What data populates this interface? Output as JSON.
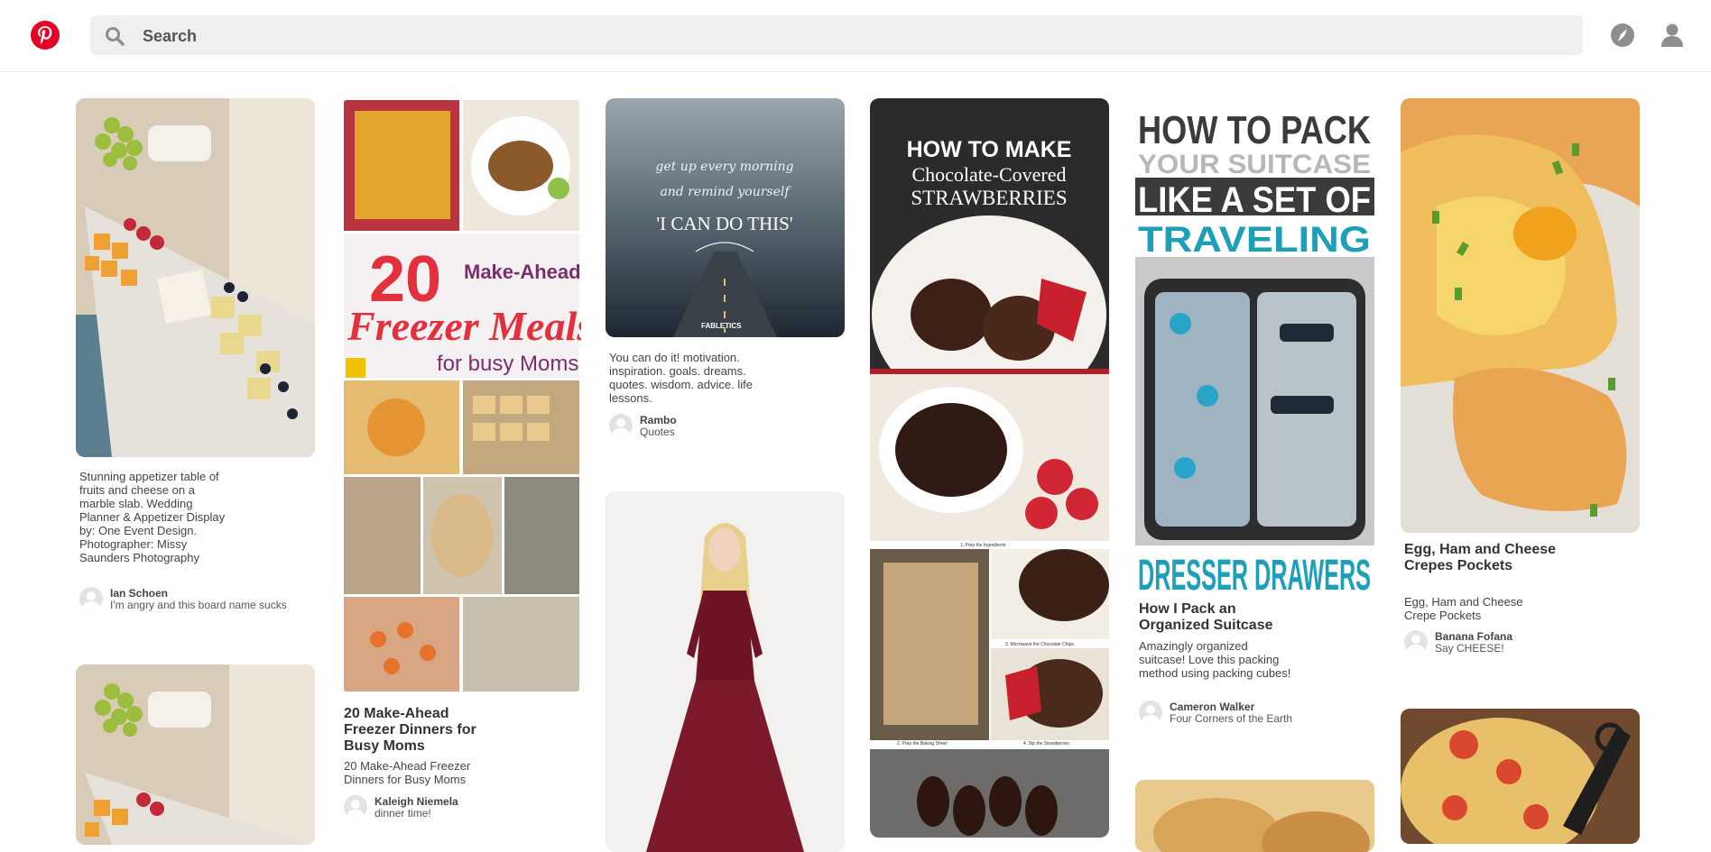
{
  "header": {
    "search_placeholder": "Search",
    "icons": [
      "pinterest-logo-icon",
      "search-icon",
      "compass-icon",
      "profile-icon"
    ],
    "brand_color": "#e60023"
  },
  "pins": [
    {
      "description": "Stunning appetizer table of fruits and cheese on a marble slab. Wedding Planner & Appetizer Display by: One Event Design. Photographer: Missy Saunders Photography",
      "user": "Ian Schoen",
      "board": "I'm angry and this board name sucks"
    },
    {
      "image_text": {
        "number": "20",
        "line1": "Make-Ahead",
        "line2": "Freezer Meals",
        "line3": "for busy Moms"
      },
      "title": "20 Make-Ahead Freezer Dinners for Busy Moms",
      "description": "20 Make-Ahead Freezer Dinners for Busy Moms",
      "user": "Kaleigh  Niemela",
      "board": "dinner time!"
    },
    {
      "image_text": {
        "script1": "get up every morning",
        "script2": "and remind yourself",
        "quote": "'I CAN DO THIS'",
        "brand": "FABLETICS"
      },
      "description": "You can do it! motivation. inspiration. goals. dreams. quotes. wisdom. advice. life lessons.",
      "user": "Rambo",
      "board": "Quotes"
    },
    {
      "image_text": {
        "line1": "HOW TO MAKE",
        "line2": "Chocolate-Covered",
        "line3": "STRAWBERRIES",
        "step1": "1. Prep the Ingredients",
        "step2": "2. Prep the Baking Sheet",
        "step3": "3. Microwave the Chocolate Chips",
        "step4": "4. Dip the Strawberries"
      }
    },
    {
      "image_text": {
        "line1": "HOW TO PACK",
        "line2": "YOUR SUITCASE",
        "line3": "LIKE A SET OF",
        "line4": "TRAVELING",
        "line5": "DRESSER DRAWERS"
      },
      "title": "How I Pack an Organized Suitcase",
      "description": "Amazingly organized suitcase! Love this packing method using packing cubes!",
      "user": "Cameron Walker",
      "board": "Four Corners of the Earth"
    },
    {
      "title": "Egg, Ham and Cheese Crepes Pockets",
      "description": "Egg, Ham and Cheese Crepe Pockets",
      "user": "Banana Fofana",
      "board": "Say CHEESE!"
    }
  ]
}
